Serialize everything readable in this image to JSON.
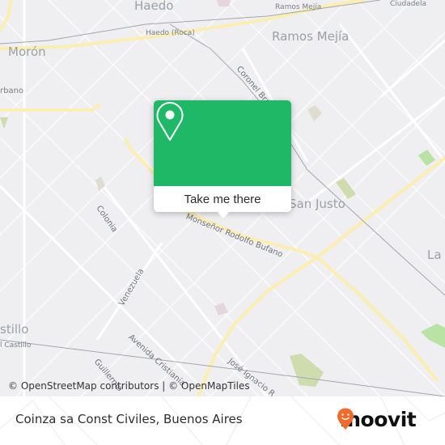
{
  "map": {
    "place_labels": {
      "haedo": "Haedo",
      "moron": "Morón",
      "ramos_mejia": "Ramos Mejía",
      "san_justo": "San Justo",
      "la": "La T",
      "castillo": "stillo",
      "hurlingham_partial": "rbano"
    },
    "station_labels": {
      "haedo_roca": "Haedo (Roca)",
      "ramos_mejia_station": "Ramos Mejía",
      "ciudadela": "Ciudadela",
      "castillo_station": "l Castillo"
    },
    "street_labels": {
      "coronel_brandsen": "Coronel Brandsen",
      "colonia": "Colonia",
      "venezuela": "Venezuela",
      "monsenor": "Monseñor Rodolfo Bufano",
      "avenida_cristiania": "Avenida Cristianía",
      "guillermo": "Guillermo",
      "jose_ignacio": "José Ignacio R"
    },
    "colors": {
      "background": "#efeff1",
      "street": "#ffffff",
      "arterial": "#fbeeb0",
      "park": "#cfdcae",
      "park_bright": "#b8e3a4",
      "rail": "#a3a6ad"
    }
  },
  "popup": {
    "icon": "map-pin-icon",
    "button_label": "Take me there",
    "accent_color": "#1fb866"
  },
  "attribution": "© OpenStreetMap contributors | © OpenMapTiles",
  "footer": {
    "title": "Coinza sa Const Civiles, Buenos Aires",
    "brand": "moovit",
    "brand_color": "#f26a2a"
  }
}
